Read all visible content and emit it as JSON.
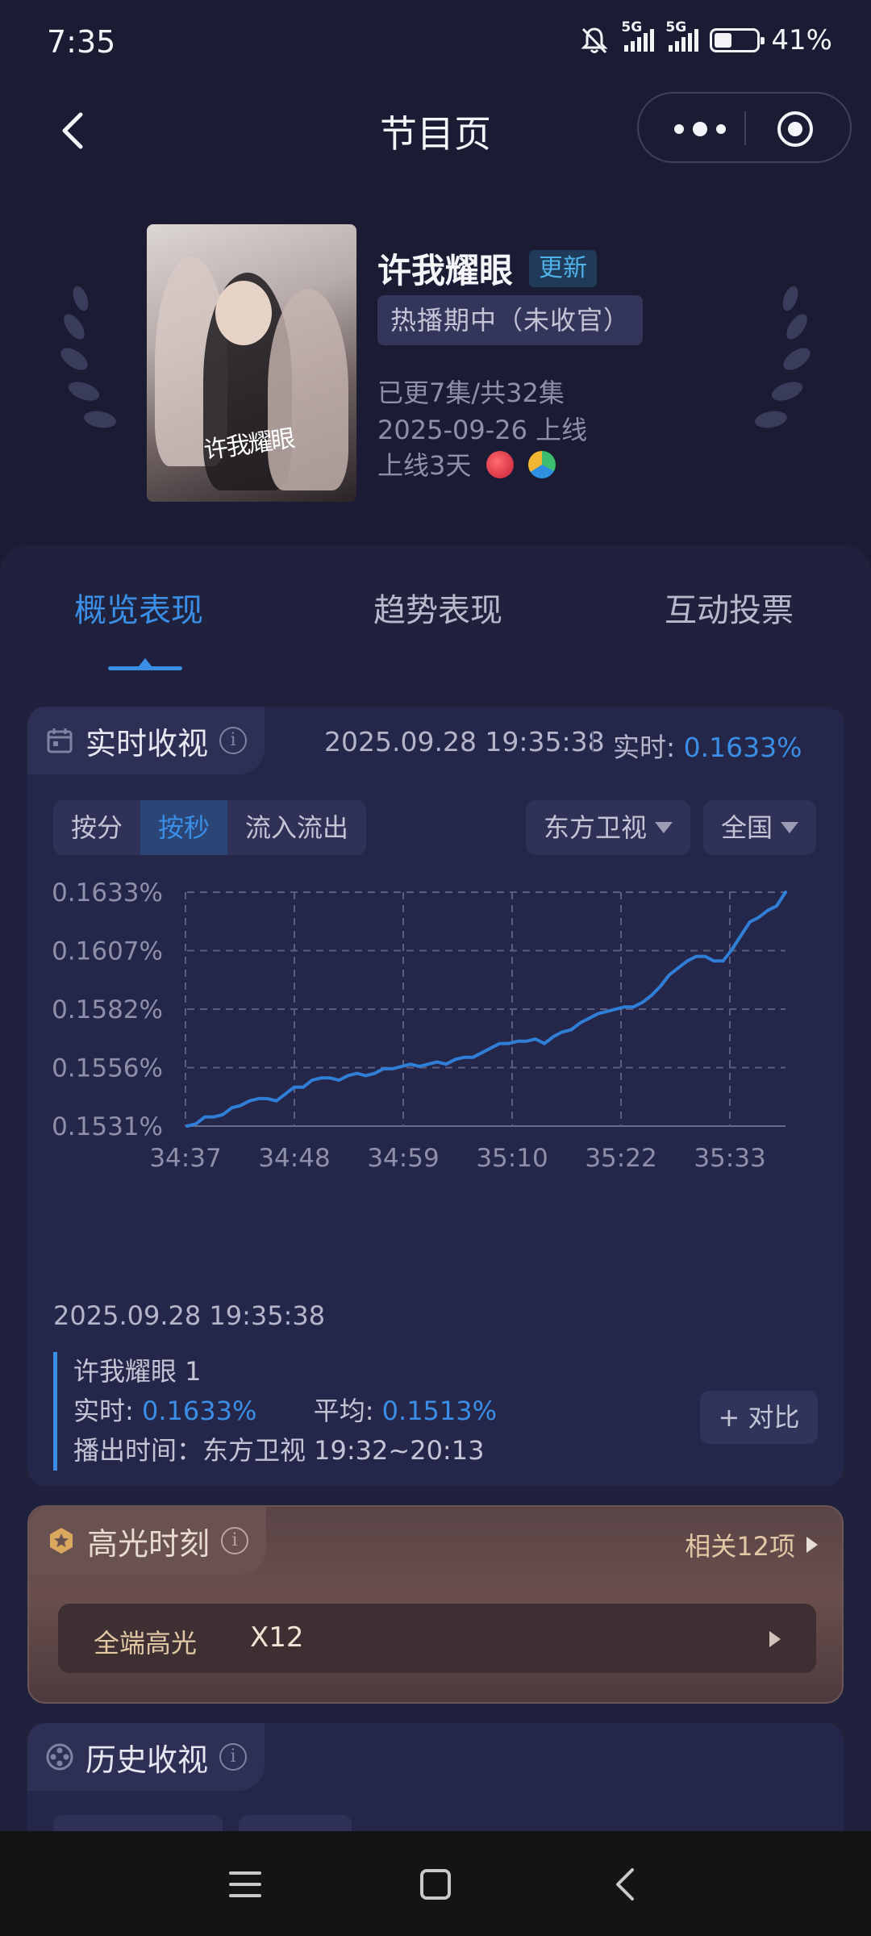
{
  "status_bar": {
    "time": "7:35",
    "signal1": "5G",
    "signal2": "5G",
    "battery_pct": "41%",
    "battery_level": 0.41
  },
  "nav": {
    "title": "节目页"
  },
  "show": {
    "title": "许我耀眼",
    "update_tag": "更新",
    "status": "热播期中（未收官）",
    "episodes": "已更7集/共32集",
    "premiere": "2025-09-26 上线",
    "days_online": "上线3天",
    "poster_title": "许我耀眼"
  },
  "tabs": [
    "概览表现",
    "趋势表现",
    "互动投票"
  ],
  "realtime": {
    "title": "实时收视",
    "timestamp": "2025.09.28 19:35:38",
    "label": "实时:",
    "value": "0.1633%",
    "modes": [
      "按分",
      "按秒",
      "流入流出"
    ],
    "active_mode": "按秒",
    "channel": "东方卫视",
    "region": "全国"
  },
  "chart_data": {
    "type": "line",
    "series": [
      {
        "values": [
          0.1531,
          0.1532,
          0.1535,
          0.1535,
          0.1536,
          0.1539,
          0.154,
          0.1542,
          0.1543,
          0.1543,
          0.1542,
          0.1545,
          0.1548,
          0.1548,
          0.1551,
          0.1552,
          0.1552,
          0.1551,
          0.1553,
          0.1554,
          0.1553,
          0.1554,
          0.1556,
          0.1556,
          0.1557,
          0.1558,
          0.1557,
          0.1558,
          0.1559,
          0.1558,
          0.156,
          0.1561,
          0.1561,
          0.1563,
          0.1565,
          0.1567,
          0.1567,
          0.1568,
          0.1568,
          0.1569,
          0.1567,
          0.157,
          0.1572,
          0.1573,
          0.1576,
          0.1578,
          0.158,
          0.1581,
          0.1582,
          0.1583,
          0.1583,
          0.1585,
          0.1588,
          0.1592,
          0.1597,
          0.16,
          0.1603,
          0.1605,
          0.1605,
          0.1603,
          0.1603,
          0.1608,
          0.1614,
          0.162,
          0.1622,
          0.1625,
          0.1627,
          0.1633
        ]
      }
    ],
    "yticks": [
      "0.1633%",
      "0.1607%",
      "0.1582%",
      "0.1556%",
      "0.1531%"
    ],
    "ylim": [
      0.1531,
      0.1633
    ],
    "xticks": [
      "34:37",
      "34:48",
      "34:59",
      "35:10",
      "35:22",
      "35:33"
    ],
    "grid": true,
    "line_color": "#2f7ed8"
  },
  "detail": {
    "timestamp": "2025.09.28 19:35:38",
    "program": "许我耀眼 1",
    "realtime_label": "实时:",
    "realtime_value": "0.1633%",
    "avg_label": "平均:",
    "avg_value": "0.1513%",
    "airtime": "播出时间：东方卫视 19:32~20:13",
    "compare_label": "+ 对比"
  },
  "highlights": {
    "title": "高光时刻",
    "related": "相关12项",
    "row_label": "全端高光",
    "row_value": "X12"
  },
  "history": {
    "title": "历史收视"
  },
  "colors": {
    "accent": "#3a8ee6",
    "background": "#1b1c33",
    "card": "#25274a",
    "highlight_gold": "#e2c8a5"
  }
}
